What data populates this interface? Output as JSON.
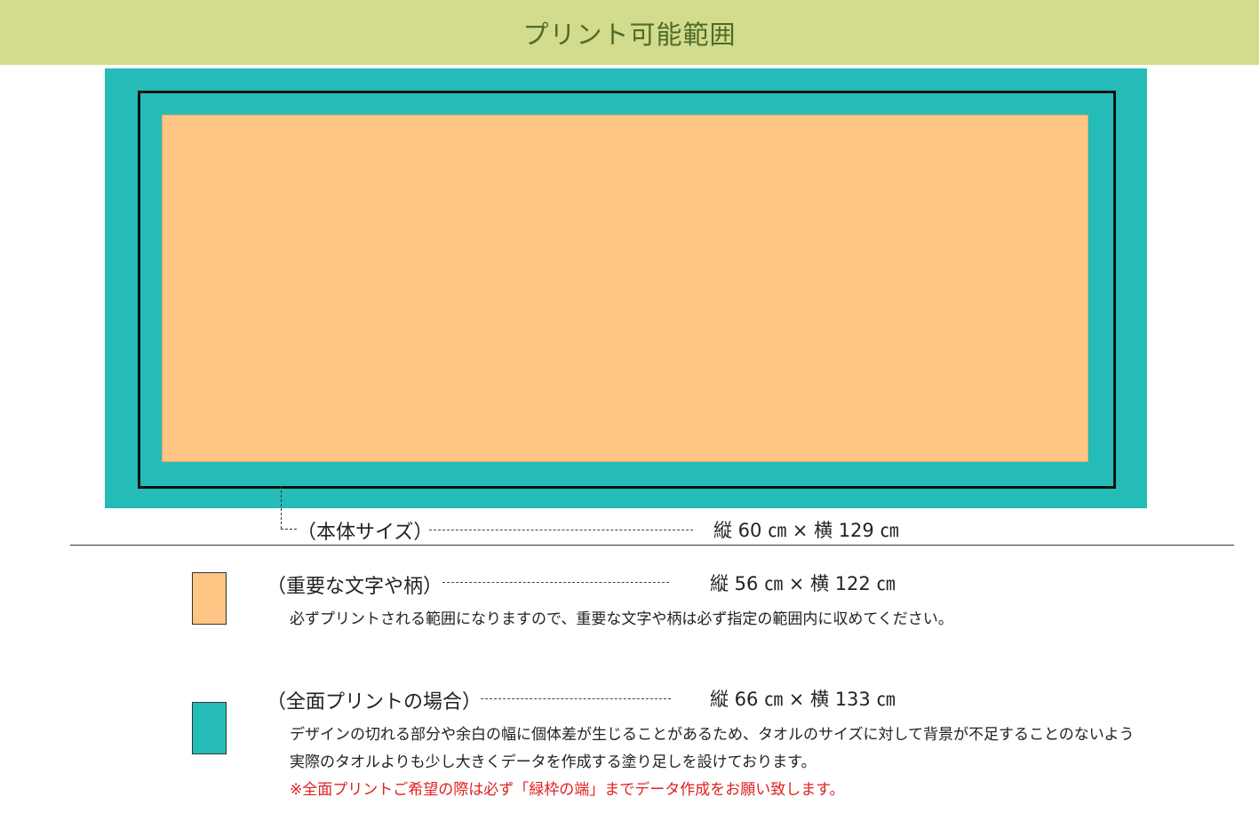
{
  "header": {
    "title": "プリント可能範囲"
  },
  "colors": {
    "header_bg": "#d3db8c",
    "full_print": "#25bcb8",
    "important": "#ffc585",
    "warning_text": "#e02020"
  },
  "body_size": {
    "label": "（本体サイズ）",
    "dimension": "縦 60 ㎝ × 横 129 ㎝"
  },
  "legend": [
    {
      "label": "（重要な文字や柄）",
      "dimension": "縦 56 ㎝ × 横 122 ㎝",
      "lines": [
        "必ずプリントされる範囲になりますので、重要な文字や柄は必ず指定の範囲内に収めてください。"
      ]
    },
    {
      "label": "（全面プリントの場合）",
      "dimension": "縦 66 ㎝ × 横 133 ㎝",
      "lines": [
        "デザインの切れる部分や余白の幅に個体差が生じることがあるため、タオルのサイズに対して背景が不足することのないよう",
        "実際のタオルよりも少し大きくデータを作成する塗り足しを設けております。"
      ],
      "warning": "※全面プリントご希望の際は必ず「緑枠の端」までデータ作成をお願い致します。"
    }
  ]
}
